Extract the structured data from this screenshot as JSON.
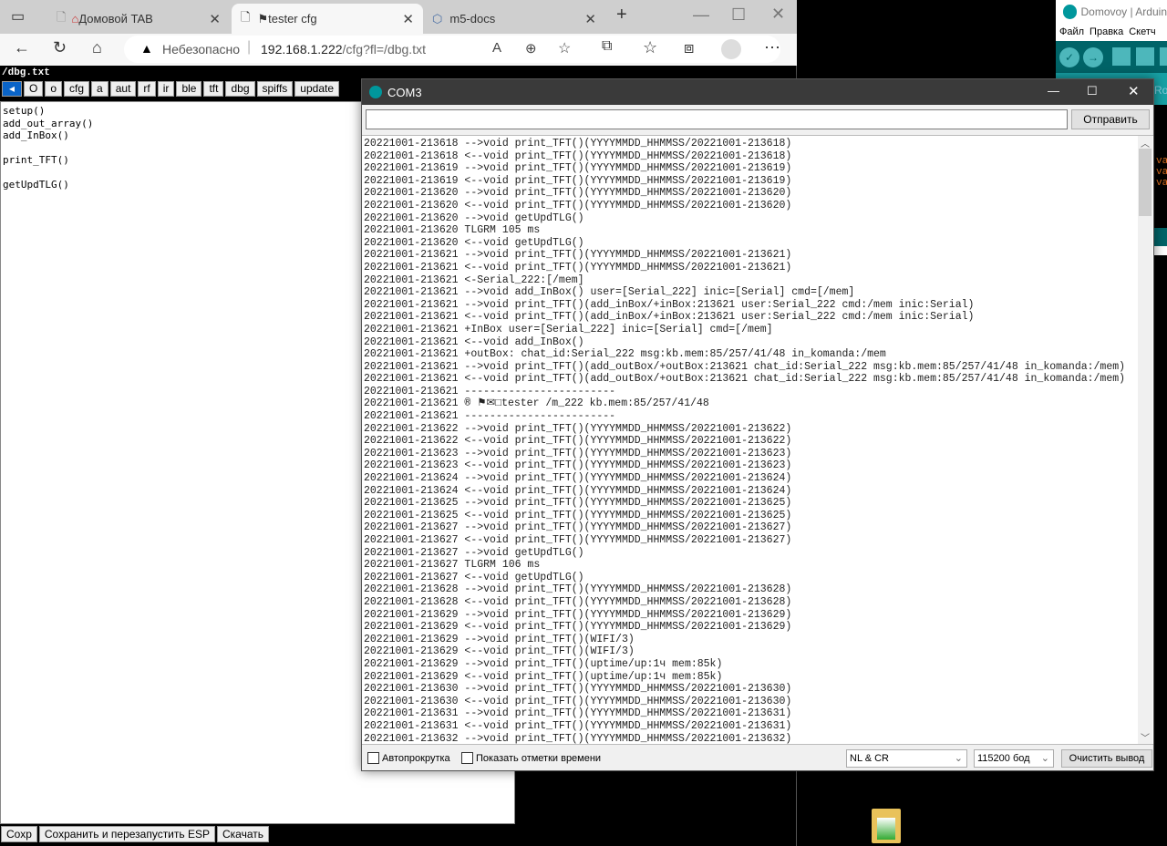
{
  "browser": {
    "tabs": [
      {
        "label": "Домовой TAB",
        "icon": "house-icon"
      },
      {
        "label": "tester cfg",
        "icon": "flag-icon",
        "active": true
      },
      {
        "label": "m5-docs",
        "icon": "cube-icon"
      }
    ],
    "security_label": "Небезопасно",
    "url_host": "192.168.1.222",
    "url_path": "/cfg?fl=/dbg.txt"
  },
  "page": {
    "path": "/dbg.txt",
    "nav_buttons": [
      "O",
      "o",
      "cfg",
      "a",
      "aut",
      "rf",
      "ir",
      "ble",
      "tft",
      "dbg",
      "spiffs",
      "update"
    ],
    "textarea": "setup()\nadd_out_array()\nadd_InBox()\n\nprint_TFT()\n\ngetUpdTLG()",
    "bottom_buttons": [
      "Сохр",
      "Сохранить и перезапустить ESP",
      "Скачать"
    ]
  },
  "arduino": {
    "title": "Domovoy | Arduin",
    "menu": [
      "Файл",
      "Правка",
      "Скетч"
    ],
    "tab_partial": "Ro",
    "accent": "#00979c"
  },
  "serial": {
    "title": "COM3",
    "send_label": "Отправить",
    "input_value": "",
    "lines": [
      "20221001-213618 -->void print_TFT()(YYYYMMDD_HHMMSS/20221001-213618)",
      "20221001-213618 <--void print_TFT()(YYYYMMDD_HHMMSS/20221001-213618)",
      "20221001-213619 -->void print_TFT()(YYYYMMDD_HHMMSS/20221001-213619)",
      "20221001-213619 <--void print_TFT()(YYYYMMDD_HHMMSS/20221001-213619)",
      "20221001-213620 -->void print_TFT()(YYYYMMDD_HHMMSS/20221001-213620)",
      "20221001-213620 <--void print_TFT()(YYYYMMDD_HHMMSS/20221001-213620)",
      "20221001-213620 -->void getUpdTLG()",
      "20221001-213620 TLGRM 105 ms",
      "20221001-213620 <--void getUpdTLG()",
      "20221001-213621 -->void print_TFT()(YYYYMMDD_HHMMSS/20221001-213621)",
      "20221001-213621 <--void print_TFT()(YYYYMMDD_HHMMSS/20221001-213621)",
      "20221001-213621 <-Serial_222:[/mem]",
      "20221001-213621 -->void add_InBox() user=[Serial_222] inic=[Serial] cmd=[/mem]",
      "20221001-213621 -->void print_TFT()(add_inBox/+inBox:213621 user:Serial_222 cmd:/mem inic:Serial)",
      "20221001-213621 <--void print_TFT()(add_inBox/+inBox:213621 user:Serial_222 cmd:/mem inic:Serial)",
      "20221001-213621 +InBox user=[Serial_222] inic=[Serial] cmd=[/mem]",
      "20221001-213621 <--void add_InBox()",
      "20221001-213621 +outBox: chat_id:Serial_222 msg:kb.mem:85/257/41/48 in_komanda:/mem",
      "20221001-213621 -->void print_TFT()(add_outBox/+outBox:213621 chat_id:Serial_222 msg:kb.mem:85/257/41/48 in_komanda:/mem)",
      "20221001-213621 <--void print_TFT()(add_outBox/+outBox:213621 chat_id:Serial_222 msg:kb.mem:85/257/41/48 in_komanda:/mem)",
      "20221001-213621 ------------------------",
      "20221001-213621 ® ⚑✉□tester /m_222 kb.mem:85/257/41/48",
      "20221001-213621 ------------------------",
      "20221001-213622 -->void print_TFT()(YYYYMMDD_HHMMSS/20221001-213622)",
      "20221001-213622 <--void print_TFT()(YYYYMMDD_HHMMSS/20221001-213622)",
      "20221001-213623 -->void print_TFT()(YYYYMMDD_HHMMSS/20221001-213623)",
      "20221001-213623 <--void print_TFT()(YYYYMMDD_HHMMSS/20221001-213623)",
      "20221001-213624 -->void print_TFT()(YYYYMMDD_HHMMSS/20221001-213624)",
      "20221001-213624 <--void print_TFT()(YYYYMMDD_HHMMSS/20221001-213624)",
      "20221001-213625 -->void print_TFT()(YYYYMMDD_HHMMSS/20221001-213625)",
      "20221001-213625 <--void print_TFT()(YYYYMMDD_HHMMSS/20221001-213625)",
      "20221001-213627 -->void print_TFT()(YYYYMMDD_HHMMSS/20221001-213627)",
      "20221001-213627 <--void print_TFT()(YYYYMMDD_HHMMSS/20221001-213627)",
      "20221001-213627 -->void getUpdTLG()",
      "20221001-213627 TLGRM 106 ms",
      "20221001-213627 <--void getUpdTLG()",
      "20221001-213628 -->void print_TFT()(YYYYMMDD_HHMMSS/20221001-213628)",
      "20221001-213628 <--void print_TFT()(YYYYMMDD_HHMMSS/20221001-213628)",
      "20221001-213629 -->void print_TFT()(YYYYMMDD_HHMMSS/20221001-213629)",
      "20221001-213629 <--void print_TFT()(YYYYMMDD_HHMMSS/20221001-213629)",
      "20221001-213629 -->void print_TFT()(WIFI/3)",
      "20221001-213629 <--void print_TFT()(WIFI/3)",
      "20221001-213629 -->void print_TFT()(uptime/up:1ч mem:85k)",
      "20221001-213629 <--void print_TFT()(uptime/up:1ч mem:85k)",
      "20221001-213630 -->void print_TFT()(YYYYMMDD_HHMMSS/20221001-213630)",
      "20221001-213630 <--void print_TFT()(YYYYMMDD_HHMMSS/20221001-213630)",
      "20221001-213631 -->void print_TFT()(YYYYMMDD_HHMMSS/20221001-213631)",
      "20221001-213631 <--void print_TFT()(YYYYMMDD_HHMMSS/20221001-213631)",
      "20221001-213632 -->void print_TFT()(YYYYMMDD_HHMMSS/20221001-213632)"
    ],
    "autoscroll_label": "Автопрокрутка",
    "timestamps_label": "Показать отметки времени",
    "line_ending": "NL & CR",
    "baud": "115200 бод",
    "clear_label": "Очистить вывод"
  }
}
